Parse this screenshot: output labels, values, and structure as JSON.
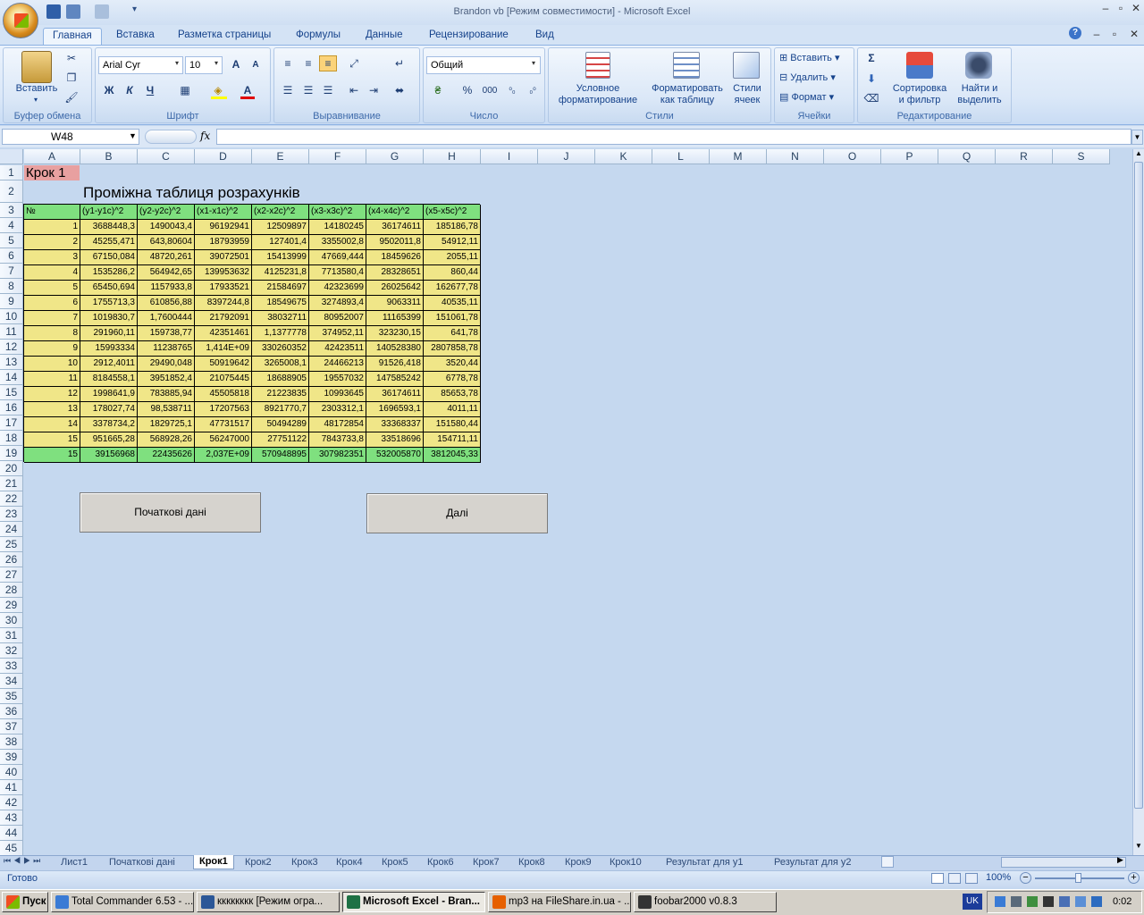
{
  "window": {
    "title": "Brandon vb  [Режим совместимости] - Microsoft Excel"
  },
  "ribbon": {
    "tabs": [
      "Главная",
      "Вставка",
      "Разметка страницы",
      "Формулы",
      "Данные",
      "Рецензирование",
      "Вид"
    ],
    "active_tab": "Главная",
    "clipboard": {
      "paste": "Вставить",
      "label": "Буфер обмена"
    },
    "font": {
      "name": "Arial Cyr",
      "size": "10",
      "bold": "Ж",
      "italic": "К",
      "underline": "Ч",
      "label": "Шрифт",
      "font_color_glyph": "A",
      "grow_glyph": "A",
      "shrink_glyph": "A"
    },
    "alignment": {
      "label": "Выравнивание"
    },
    "number": {
      "format": "Общий",
      "percent": "%",
      "thousands": "000",
      "label": "Число"
    },
    "styles": {
      "conditional": [
        "Условное",
        "форматирование"
      ],
      "as_table": [
        "Форматировать",
        "как таблицу"
      ],
      "cell_styles": [
        "Стили",
        "ячеек"
      ],
      "label": "Стили"
    },
    "cells": {
      "insert": "Вставить",
      "delete": "Удалить",
      "format": "Формат",
      "label": "Ячейки"
    },
    "editing": {
      "sum": "Σ",
      "sort": [
        "Сортировка",
        "и фильтр"
      ],
      "find": [
        "Найти и",
        "выделить"
      ],
      "label": "Редактирование"
    }
  },
  "formula_bar": {
    "name_box": "W48",
    "fx": "fx",
    "value": ""
  },
  "columns": [
    "A",
    "B",
    "C",
    "D",
    "E",
    "F",
    "G",
    "H",
    "I",
    "J",
    "K",
    "L",
    "M",
    "N",
    "O",
    "P",
    "Q",
    "R",
    "S"
  ],
  "rows_count": 45,
  "sheet": {
    "step_label": "Крок 1",
    "table_title": "Проміжна таблиця розрахунків",
    "headers": [
      "№",
      "(y1-y1c)^2",
      "(y2-y2c)^2",
      "(x1-x1c)^2",
      "(x2-x2c)^2",
      "(x3-x3c)^2",
      "(x4-x4c)^2",
      "(x5-x5c)^2"
    ],
    "rows": [
      [
        "1",
        "3688448,3",
        "1490043,4",
        "96192941",
        "12509897",
        "14180245",
        "36174611",
        "185186,78"
      ],
      [
        "2",
        "45255,471",
        "643,80604",
        "18793959",
        "127401,4",
        "3355002,8",
        "9502011,8",
        "54912,11"
      ],
      [
        "3",
        "67150,084",
        "48720,261",
        "39072501",
        "15413999",
        "47669,444",
        "18459626",
        "2055,11"
      ],
      [
        "4",
        "1535286,2",
        "564942,65",
        "139953632",
        "4125231,8",
        "7713580,4",
        "28328651",
        "860,44"
      ],
      [
        "5",
        "65450,694",
        "1157933,8",
        "17933521",
        "21584697",
        "42323699",
        "26025642",
        "162677,78"
      ],
      [
        "6",
        "1755713,3",
        "610856,88",
        "8397244,8",
        "18549675",
        "3274893,4",
        "9063311",
        "40535,11"
      ],
      [
        "7",
        "1019830,7",
        "1,7600444",
        "21792091",
        "38032711",
        "80952007",
        "11165399",
        "151061,78"
      ],
      [
        "8",
        "291960,11",
        "159738,77",
        "42351461",
        "1,1377778",
        "374952,11",
        "323230,15",
        "641,78"
      ],
      [
        "9",
        "15993334",
        "11238765",
        "1,414E+09",
        "330260352",
        "42423511",
        "140528380",
        "2807858,78"
      ],
      [
        "10",
        "2912,4011",
        "29490,048",
        "50919642",
        "3265008,1",
        "24466213",
        "91526,418",
        "3520,44"
      ],
      [
        "11",
        "8184558,1",
        "3951852,4",
        "21075445",
        "18688905",
        "19557032",
        "147585242",
        "6778,78"
      ],
      [
        "12",
        "1998641,9",
        "783885,94",
        "45505818",
        "21223835",
        "10993645",
        "36174611",
        "85653,78"
      ],
      [
        "13",
        "178027,74",
        "98,538711",
        "17207563",
        "8921770,7",
        "2303312,1",
        "1696593,1",
        "4011,11"
      ],
      [
        "14",
        "3378734,2",
        "1829725,1",
        "47731517",
        "50494289",
        "48172854",
        "33368337",
        "151580,44"
      ],
      [
        "15",
        "951665,28",
        "568928,26",
        "56247000",
        "27751122",
        "7843733,8",
        "33518696",
        "154711,11"
      ]
    ],
    "total_row": [
      "15",
      "39156968",
      "22435626",
      "2,037E+09",
      "570948895",
      "307982351",
      "532005870",
      "3812045,33"
    ],
    "buttons": {
      "initial_data": "Початкові дані",
      "next": "Далі"
    }
  },
  "sheet_tabs": [
    "Лист1",
    "Початкові дані",
    "Крок1",
    "Крок2",
    "Крок3",
    "Крок4",
    "Крок5",
    "Крок6",
    "Крок7",
    "Крок8",
    "Крок9",
    "Крок10",
    "Результат для y1",
    "Результат для y2"
  ],
  "active_sheet": "Крок1",
  "status": {
    "ready": "Готово",
    "zoom": "100%"
  },
  "taskbar": {
    "start": "Пуск",
    "items": [
      "Total Commander 6.53 - ...",
      "кккккккк [Режим огра...",
      "Microsoft Excel - Bran...",
      "mp3 на FileShare.in.ua - ...",
      "foobar2000 v0.8.3"
    ],
    "active_index": 2,
    "lang": "UK",
    "clock": "0:02"
  },
  "colors": {
    "header_green": "#7fe07f",
    "data_yellow": "#f0e688",
    "step_pink": "#e8a0a0",
    "grid_bg": "#c5d8ef"
  }
}
